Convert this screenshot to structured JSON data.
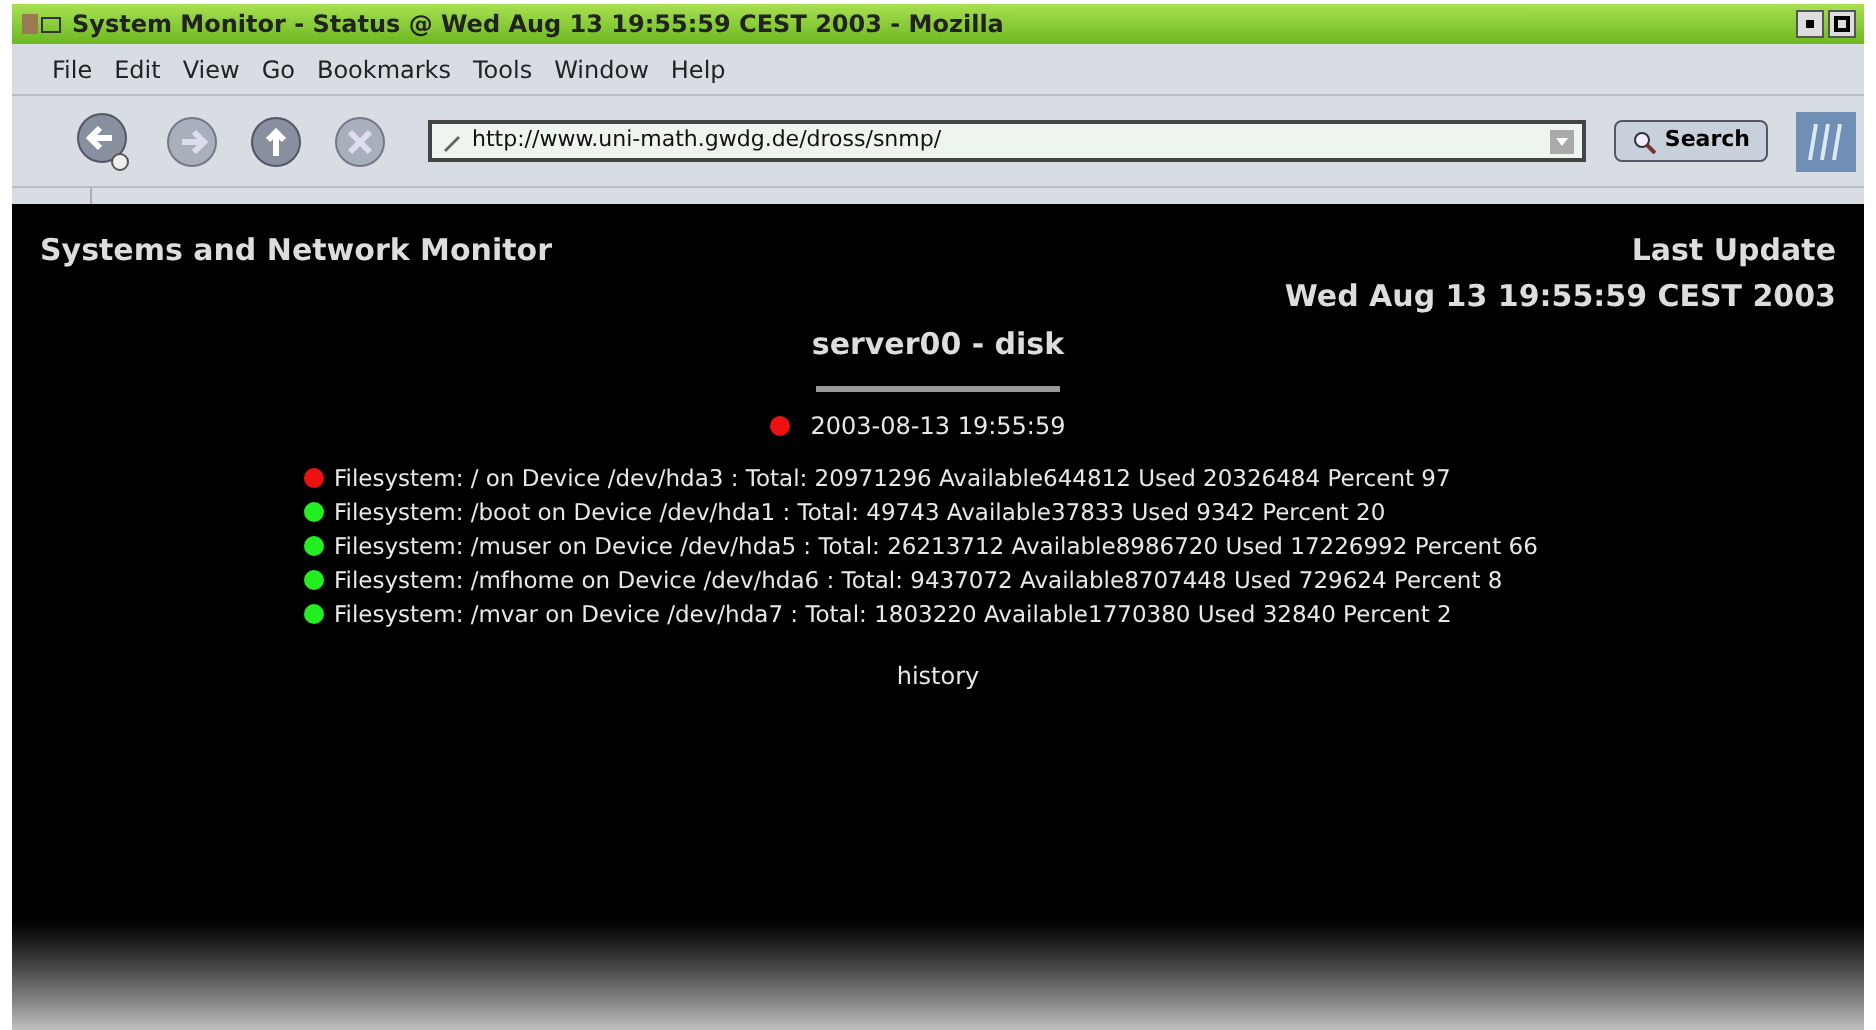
{
  "window": {
    "title": "System Monitor - Status @ Wed Aug 13 19:55:59 CEST 2003 - Mozilla"
  },
  "menu": [
    "File",
    "Edit",
    "View",
    "Go",
    "Bookmarks",
    "Tools",
    "Window",
    "Help"
  ],
  "toolbar": {
    "url": "http://www.uni-math.gwdg.de/dross/snmp/",
    "search_button": "Search"
  },
  "page": {
    "site_title": "Systems and Network Monitor",
    "update_label": "Last Update",
    "update_time": "Wed Aug 13 19:55:59 CEST 2003",
    "heading": "server00 - disk",
    "status": {
      "color": "#ee1111",
      "time": "2003-08-13 19:55:59"
    },
    "filesystems": [
      {
        "color": "#ee1111",
        "text": "Filesystem: / on Device /dev/hda3 : Total: 20971296 Available644812 Used 20326484 Percent 97"
      },
      {
        "color": "#22ee22",
        "text": "Filesystem: /boot on Device /dev/hda1 : Total: 49743 Available37833 Used 9342 Percent 20"
      },
      {
        "color": "#22ee22",
        "text": "Filesystem: /muser on Device /dev/hda5 : Total: 26213712 Available8986720 Used 17226992 Percent 66"
      },
      {
        "color": "#22ee22",
        "text": "Filesystem: /mfhome on Device /dev/hda6 : Total: 9437072 Available8707448 Used 729624 Percent 8"
      },
      {
        "color": "#22ee22",
        "text": "Filesystem: /mvar on Device /dev/hda7 : Total: 1803220 Available1770380 Used 32840 Percent 2"
      }
    ],
    "history_link": "history"
  }
}
